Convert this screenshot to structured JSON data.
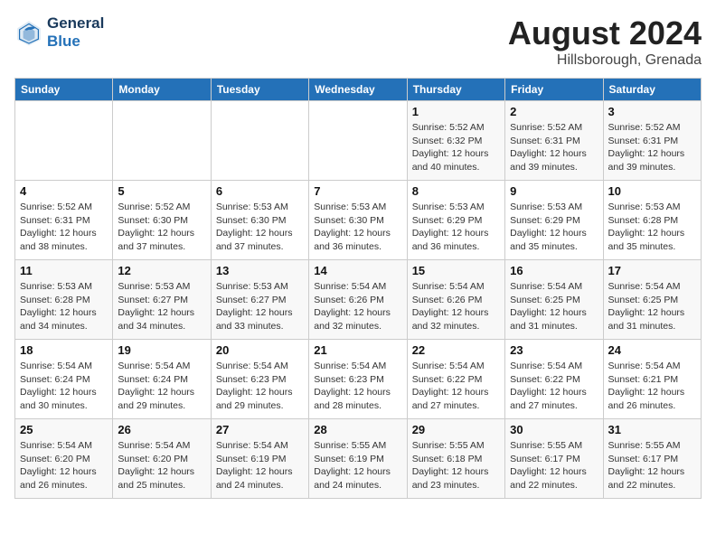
{
  "header": {
    "logo_line1": "General",
    "logo_line2": "Blue",
    "month_year": "August 2024",
    "location": "Hillsborough, Grenada"
  },
  "weekdays": [
    "Sunday",
    "Monday",
    "Tuesday",
    "Wednesday",
    "Thursday",
    "Friday",
    "Saturday"
  ],
  "weeks": [
    [
      {
        "day": "",
        "info": ""
      },
      {
        "day": "",
        "info": ""
      },
      {
        "day": "",
        "info": ""
      },
      {
        "day": "",
        "info": ""
      },
      {
        "day": "1",
        "info": "Sunrise: 5:52 AM\nSunset: 6:32 PM\nDaylight: 12 hours\nand 40 minutes."
      },
      {
        "day": "2",
        "info": "Sunrise: 5:52 AM\nSunset: 6:31 PM\nDaylight: 12 hours\nand 39 minutes."
      },
      {
        "day": "3",
        "info": "Sunrise: 5:52 AM\nSunset: 6:31 PM\nDaylight: 12 hours\nand 39 minutes."
      }
    ],
    [
      {
        "day": "4",
        "info": "Sunrise: 5:52 AM\nSunset: 6:31 PM\nDaylight: 12 hours\nand 38 minutes."
      },
      {
        "day": "5",
        "info": "Sunrise: 5:52 AM\nSunset: 6:30 PM\nDaylight: 12 hours\nand 37 minutes."
      },
      {
        "day": "6",
        "info": "Sunrise: 5:53 AM\nSunset: 6:30 PM\nDaylight: 12 hours\nand 37 minutes."
      },
      {
        "day": "7",
        "info": "Sunrise: 5:53 AM\nSunset: 6:30 PM\nDaylight: 12 hours\nand 36 minutes."
      },
      {
        "day": "8",
        "info": "Sunrise: 5:53 AM\nSunset: 6:29 PM\nDaylight: 12 hours\nand 36 minutes."
      },
      {
        "day": "9",
        "info": "Sunrise: 5:53 AM\nSunset: 6:29 PM\nDaylight: 12 hours\nand 35 minutes."
      },
      {
        "day": "10",
        "info": "Sunrise: 5:53 AM\nSunset: 6:28 PM\nDaylight: 12 hours\nand 35 minutes."
      }
    ],
    [
      {
        "day": "11",
        "info": "Sunrise: 5:53 AM\nSunset: 6:28 PM\nDaylight: 12 hours\nand 34 minutes."
      },
      {
        "day": "12",
        "info": "Sunrise: 5:53 AM\nSunset: 6:27 PM\nDaylight: 12 hours\nand 34 minutes."
      },
      {
        "day": "13",
        "info": "Sunrise: 5:53 AM\nSunset: 6:27 PM\nDaylight: 12 hours\nand 33 minutes."
      },
      {
        "day": "14",
        "info": "Sunrise: 5:54 AM\nSunset: 6:26 PM\nDaylight: 12 hours\nand 32 minutes."
      },
      {
        "day": "15",
        "info": "Sunrise: 5:54 AM\nSunset: 6:26 PM\nDaylight: 12 hours\nand 32 minutes."
      },
      {
        "day": "16",
        "info": "Sunrise: 5:54 AM\nSunset: 6:25 PM\nDaylight: 12 hours\nand 31 minutes."
      },
      {
        "day": "17",
        "info": "Sunrise: 5:54 AM\nSunset: 6:25 PM\nDaylight: 12 hours\nand 31 minutes."
      }
    ],
    [
      {
        "day": "18",
        "info": "Sunrise: 5:54 AM\nSunset: 6:24 PM\nDaylight: 12 hours\nand 30 minutes."
      },
      {
        "day": "19",
        "info": "Sunrise: 5:54 AM\nSunset: 6:24 PM\nDaylight: 12 hours\nand 29 minutes."
      },
      {
        "day": "20",
        "info": "Sunrise: 5:54 AM\nSunset: 6:23 PM\nDaylight: 12 hours\nand 29 minutes."
      },
      {
        "day": "21",
        "info": "Sunrise: 5:54 AM\nSunset: 6:23 PM\nDaylight: 12 hours\nand 28 minutes."
      },
      {
        "day": "22",
        "info": "Sunrise: 5:54 AM\nSunset: 6:22 PM\nDaylight: 12 hours\nand 27 minutes."
      },
      {
        "day": "23",
        "info": "Sunrise: 5:54 AM\nSunset: 6:22 PM\nDaylight: 12 hours\nand 27 minutes."
      },
      {
        "day": "24",
        "info": "Sunrise: 5:54 AM\nSunset: 6:21 PM\nDaylight: 12 hours\nand 26 minutes."
      }
    ],
    [
      {
        "day": "25",
        "info": "Sunrise: 5:54 AM\nSunset: 6:20 PM\nDaylight: 12 hours\nand 26 minutes."
      },
      {
        "day": "26",
        "info": "Sunrise: 5:54 AM\nSunset: 6:20 PM\nDaylight: 12 hours\nand 25 minutes."
      },
      {
        "day": "27",
        "info": "Sunrise: 5:54 AM\nSunset: 6:19 PM\nDaylight: 12 hours\nand 24 minutes."
      },
      {
        "day": "28",
        "info": "Sunrise: 5:55 AM\nSunset: 6:19 PM\nDaylight: 12 hours\nand 24 minutes."
      },
      {
        "day": "29",
        "info": "Sunrise: 5:55 AM\nSunset: 6:18 PM\nDaylight: 12 hours\nand 23 minutes."
      },
      {
        "day": "30",
        "info": "Sunrise: 5:55 AM\nSunset: 6:17 PM\nDaylight: 12 hours\nand 22 minutes."
      },
      {
        "day": "31",
        "info": "Sunrise: 5:55 AM\nSunset: 6:17 PM\nDaylight: 12 hours\nand 22 minutes."
      }
    ]
  ]
}
